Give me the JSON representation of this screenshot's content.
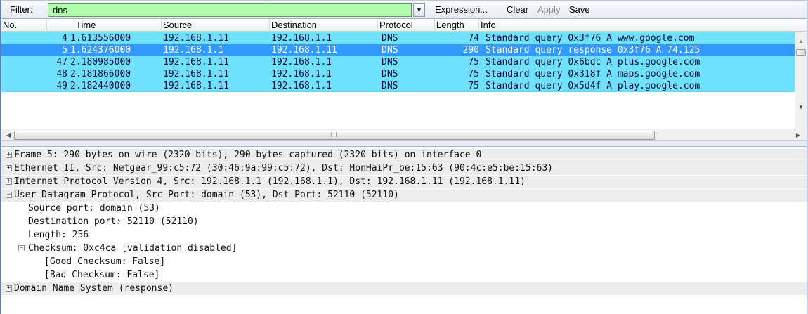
{
  "filter": {
    "label": "Filter:",
    "value": "dns",
    "expression_label": "Expression...",
    "clear_label": "Clear",
    "apply_label": "Apply",
    "save_label": "Save"
  },
  "packet_list": {
    "columns": [
      "No.",
      "Time",
      "Source",
      "Destination",
      "Protocol",
      "Length",
      "Info"
    ],
    "rows": [
      {
        "no": "4",
        "time": "1.613556000",
        "source": "192.168.1.11",
        "destination": "192.168.1.1",
        "protocol": "DNS",
        "length": "74",
        "info": "Standard query 0x3f76  A www.google.com",
        "selected": false
      },
      {
        "no": "5",
        "time": "1.624376000",
        "source": "192.168.1.1",
        "destination": "192.168.1.11",
        "protocol": "DNS",
        "length": "290",
        "info": "Standard query response 0x3f76  A 74.125",
        "selected": true
      },
      {
        "no": "47",
        "time": "2.180985000",
        "source": "192.168.1.11",
        "destination": "192.168.1.1",
        "protocol": "DNS",
        "length": "75",
        "info": "Standard query 0x6bdc  A plus.google.com",
        "selected": false
      },
      {
        "no": "48",
        "time": "2.181866000",
        "source": "192.168.1.11",
        "destination": "192.168.1.1",
        "protocol": "DNS",
        "length": "75",
        "info": "Standard query 0x318f  A maps.google.com",
        "selected": false
      },
      {
        "no": "49",
        "time": "2.182440000",
        "source": "192.168.1.11",
        "destination": "192.168.1.1",
        "protocol": "DNS",
        "length": "75",
        "info": "Standard query 0x5d4f  A play.google.com",
        "selected": false
      }
    ],
    "hscroll_grip": "III"
  },
  "details": [
    {
      "text": "Frame 5: 290 bytes on wire (2320 bits), 290 bytes captured (2320 bits) on interface 0",
      "level": 0,
      "expander": "+"
    },
    {
      "text": "Ethernet II, Src: Netgear_99:c5:72 (30:46:9a:99:c5:72), Dst: HonHaiPr_be:15:63 (90:4c:e5:be:15:63)",
      "level": 0,
      "expander": "+"
    },
    {
      "text": "Internet Protocol Version 4, Src: 192.168.1.1 (192.168.1.1), Dst: 192.168.1.11 (192.168.1.11)",
      "level": 0,
      "expander": "+"
    },
    {
      "text": "User Datagram Protocol, Src Port: domain (53), Dst Port: 52110 (52110)",
      "level": 0,
      "expander": "−"
    },
    {
      "text": "Source port: domain (53)",
      "level": 1,
      "expander": ""
    },
    {
      "text": "Destination port: 52110 (52110)",
      "level": 1,
      "expander": ""
    },
    {
      "text": "Length: 256",
      "level": 1,
      "expander": ""
    },
    {
      "text": "Checksum: 0xc4ca [validation disabled]",
      "level": 1,
      "expander": "−"
    },
    {
      "text": "[Good Checksum: False]",
      "level": 2,
      "expander": ""
    },
    {
      "text": "[Bad Checksum: False]",
      "level": 2,
      "expander": ""
    },
    {
      "text": "Domain Name System (response)",
      "level": 0,
      "expander": "+"
    }
  ],
  "colors": {
    "filter_valid_bg": "#afffaf",
    "dns_row_bg": "#70e0ff",
    "selected_row_bg": "#3399ff"
  }
}
